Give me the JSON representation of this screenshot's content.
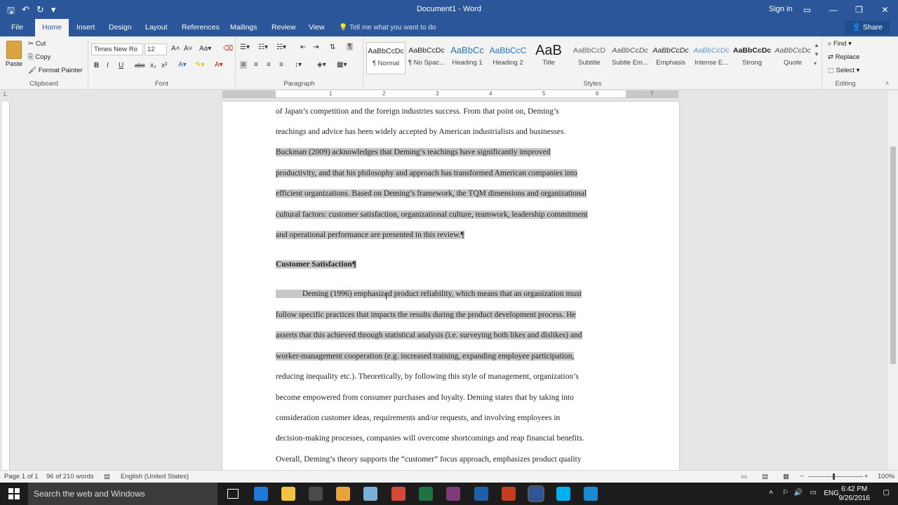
{
  "window": {
    "title": "Document1 - Word",
    "signin": "Sign in",
    "controls": [
      "—",
      "❐",
      "✕"
    ]
  },
  "tabs": [
    "File",
    "Home",
    "Insert",
    "Design",
    "Layout",
    "References",
    "Mailings",
    "Review",
    "View"
  ],
  "active_tab": "Home",
  "tell_me": "Tell me what you want to do",
  "share": "Share",
  "clipboard": {
    "paste": "Paste",
    "cut": "Cut",
    "copy": "Copy",
    "format_painter": "Format Painter",
    "label": "Clipboard"
  },
  "font": {
    "name": "Times New Ro",
    "size": "12",
    "label": "Font",
    "bold": "B",
    "italic": "I",
    "underline": "U",
    "strikethrough": "abc",
    "subscript": "x₂",
    "superscript": "x²"
  },
  "paragraph": {
    "label": "Paragraph"
  },
  "styles": {
    "label": "Styles",
    "items": [
      {
        "sample": "AaBbCcDc",
        "name": "¶ Normal"
      },
      {
        "sample": "AaBbCcDc",
        "name": "¶ No Spac..."
      },
      {
        "sample": "AaBbCc",
        "name": "Heading 1"
      },
      {
        "sample": "AaBbCcC",
        "name": "Heading 2"
      },
      {
        "sample": "AaB",
        "name": "Title"
      },
      {
        "sample": "AaBbCcD",
        "name": "Subtitle"
      },
      {
        "sample": "AaBbCcDc",
        "name": "Subtle Em..."
      },
      {
        "sample": "AaBbCcDc",
        "name": "Emphasis"
      },
      {
        "sample": "AaBbCcDc",
        "name": "Intense E..."
      },
      {
        "sample": "AaBbCcDc",
        "name": "Strong"
      },
      {
        "sample": "AaBbCcDc",
        "name": "Quote"
      }
    ]
  },
  "editing": {
    "label": "Editing",
    "find": "Find",
    "replace": "Replace",
    "select": "Select"
  },
  "ruler": {
    "numbers": [
      "1",
      "2",
      "3",
      "4",
      "5",
      "6",
      "7"
    ]
  },
  "document": {
    "lines": [
      {
        "text": "of Japan’s competition and the foreign industries success. From that point on, Deming’s",
        "hl": false
      },
      {
        "text": "teachings and advice has been widely accepted by American industrialists and businesses.",
        "hl": false
      },
      {
        "text": "Buckman (2009) acknowledges that Deming’s teachings have significantly improved",
        "hl": true
      },
      {
        "text": "productivity, and that his philosophy and approach has transformed American companies into",
        "hl": true
      },
      {
        "text": "efficient organizations. Based on Deming’s framework, the TQM dimensions and organizational",
        "hl": true
      },
      {
        "text": "cultural factors: customer satisfaction, organizational culture, teamwork, leadership commitment",
        "hl": true
      },
      {
        "text": "and operational performance are presented in this review.¶",
        "hl": true
      },
      {
        "text": "Customer Satisfaction¶",
        "hl": true,
        "heading": true
      },
      {
        "text": "Deming (1996) emphasized product reliability, which means that an organization must",
        "hl": true,
        "indent": true
      },
      {
        "text": "follow specific practices that impacts the results during the product development process. He",
        "hl": true
      },
      {
        "text": "asserts that this achieved through statistical analysis (i.e. surveying both likes and dislikes) and",
        "hl": true
      },
      {
        "text": "worker-management cooperation (e.g. increased training, expanding employee participation,",
        "hl": true
      },
      {
        "text": "reducing inequality etc.). Theoretically, by following this style of management, organization’s",
        "hl": false
      },
      {
        "text": "become empowered from consumer purchases and loyalty. Deming states that by taking into",
        "hl": false
      },
      {
        "text": "consideration customer ideas, requirements and/or requests, and involving employees in",
        "hl": false
      },
      {
        "text": "decision-making processes, companies will overcome shortcomings and reap financial benefits.",
        "hl": false
      },
      {
        "text": "Overall, Deming’s theory supports the “customer” focus approach, emphasizes product quality",
        "hl": false
      }
    ]
  },
  "status": {
    "page": "Page 1 of 1",
    "words": "96 of 210 words",
    "language": "English (United States)",
    "zoom": "100%"
  },
  "taskbar": {
    "search_placeholder": "Search the web and Windows",
    "language": "ENG",
    "time": "6:42 PM",
    "date": "9/26/2016",
    "apps": [
      {
        "name": "task-view-icon",
        "color": "#1c1c1c"
      },
      {
        "name": "edge-icon",
        "color": "#1e7ad6"
      },
      {
        "name": "file-explorer-icon",
        "color": "#f0c341"
      },
      {
        "name": "store-icon",
        "color": "#4a4a4a"
      },
      {
        "name": "media-icon",
        "color": "#e8a33a"
      },
      {
        "name": "paint-icon",
        "color": "#7ab0d8"
      },
      {
        "name": "chrome-icon",
        "color": "#d34a3a"
      },
      {
        "name": "excel-icon",
        "color": "#1f7244"
      },
      {
        "name": "onenote-icon",
        "color": "#80397b"
      },
      {
        "name": "outlook-icon",
        "color": "#1f5fa8"
      },
      {
        "name": "powerpoint-icon",
        "color": "#c43e1c"
      },
      {
        "name": "word-icon",
        "color": "#2b579a"
      },
      {
        "name": "skype-icon",
        "color": "#00aff0"
      },
      {
        "name": "camera-icon",
        "color": "#1a8ad4"
      }
    ]
  },
  "colors": {
    "brand": "#2b579a",
    "selection": "#c8c8c8"
  }
}
